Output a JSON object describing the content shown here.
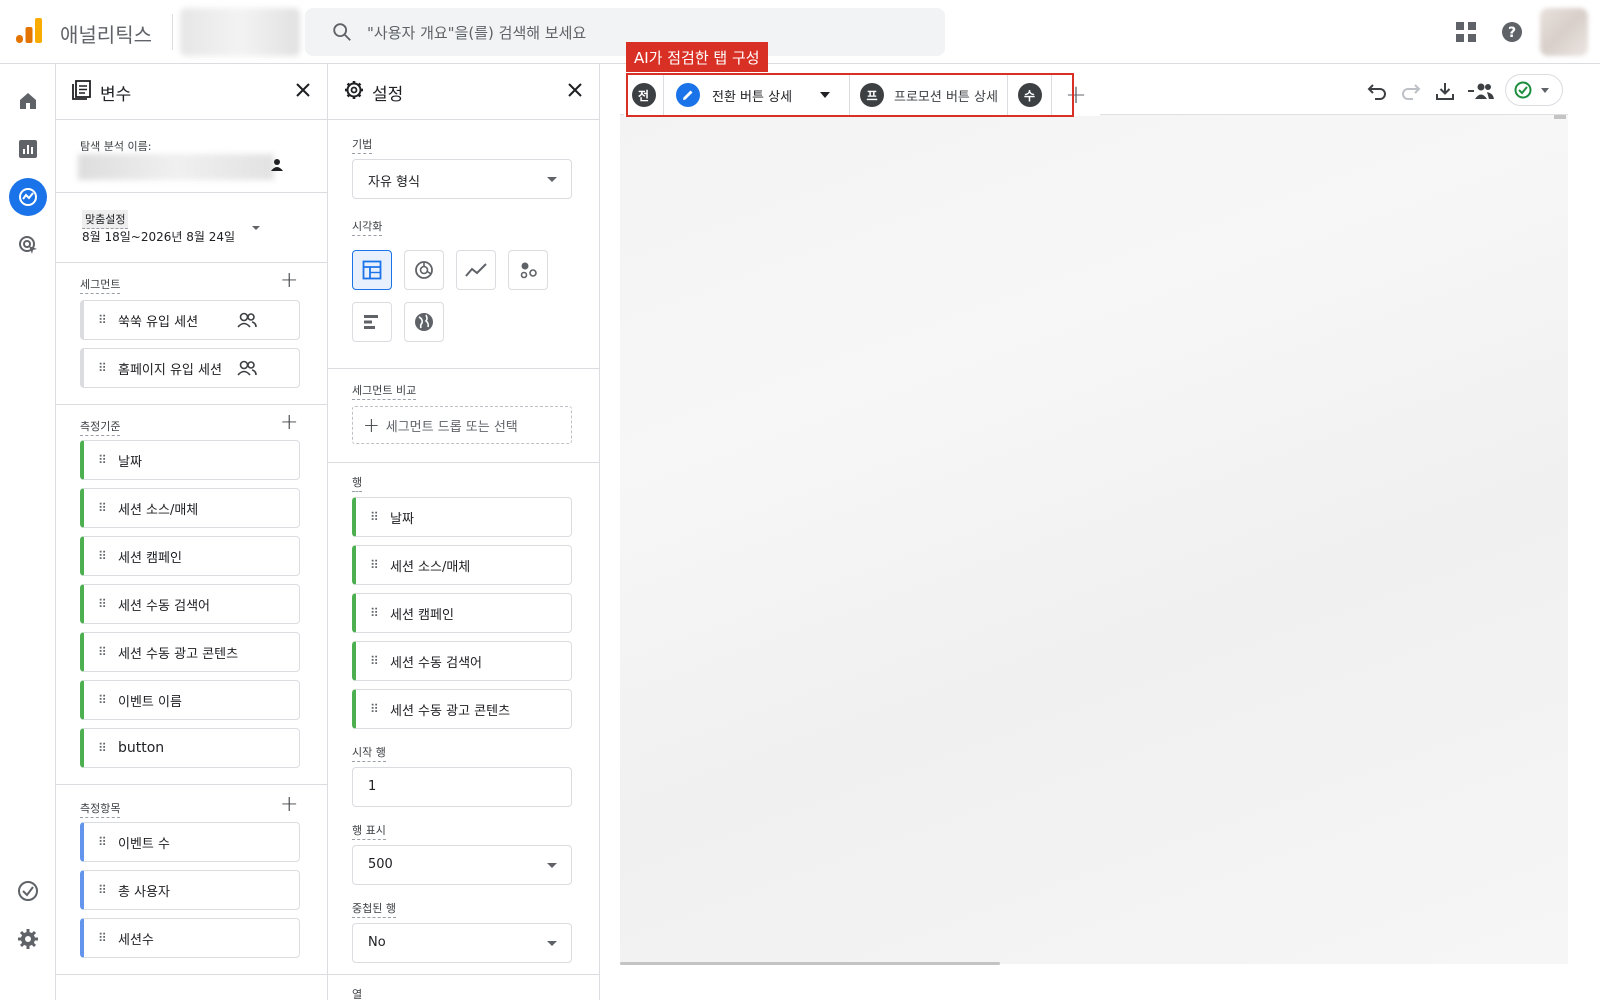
{
  "header": {
    "app_title": "애널리틱스",
    "search_placeholder": "\"사용자 개요\"을(를) 검색해 보세요"
  },
  "variables_panel": {
    "title": "변수",
    "exploration_name_label": "탐색 분석 이름:",
    "date_custom_label": "맞춤설정",
    "date_range": "8월 18일~2026년 8월 24일",
    "segments_label": "세그먼트",
    "segments": [
      "쑥쑥 유입 세션",
      "홈페이지 유입 세션"
    ],
    "dimensions_label": "측정기준",
    "dimensions": [
      "날짜",
      "세션 소스/매체",
      "세션 캠페인",
      "세션 수동 검색어",
      "세션 수동 광고 콘텐츠",
      "이벤트 이름",
      "button"
    ],
    "metrics_label": "측정항목",
    "metrics": [
      "이벤트 수",
      "총 사용자",
      "세션수"
    ]
  },
  "settings_panel": {
    "title": "설정",
    "technique_label": "기법",
    "technique_value": "자유 형식",
    "visualization_label": "시각화",
    "segment_compare_label": "세그먼트 비교",
    "segment_drop_text": "세그먼트 드롭 또는 선택",
    "rows_label": "행",
    "rows": [
      "날짜",
      "세션 소스/매체",
      "세션 캠페인",
      "세션 수동 검색어",
      "세션 수동 광고 콘텐츠"
    ],
    "start_row_label": "시작 행",
    "start_row_value": "1",
    "show_rows_label": "행 표시",
    "show_rows_value": "500",
    "nested_rows_label": "중첩된 행",
    "nested_rows_value": "No",
    "columns_label": "열"
  },
  "tabs": {
    "tab1_initial": "전",
    "tab2_label": "전환 버튼 상세",
    "tab3_initial": "프",
    "tab3_label": "프로모션 버튼 상세",
    "tab4_initial": "수"
  },
  "annotation": {
    "label": "AI가 점검한 탭 구성",
    "color": "#d93025"
  },
  "colors": {
    "accent": "#1a73e8",
    "dimension": "#4caf50",
    "metric": "#6495ed",
    "status_ok": "#1e8e3e"
  }
}
